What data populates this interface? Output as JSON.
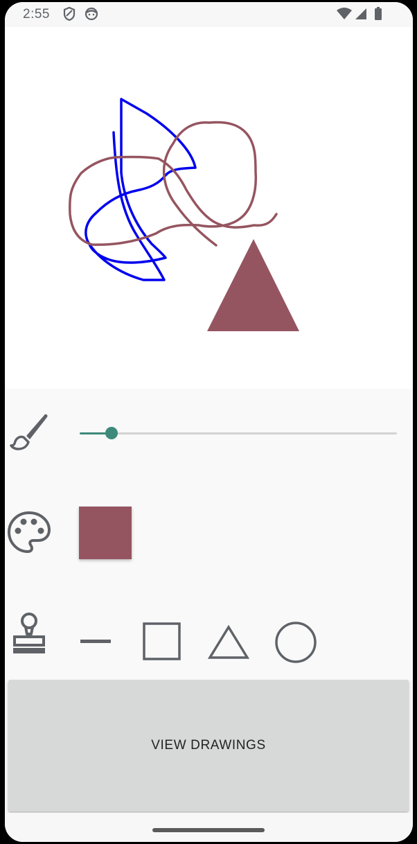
{
  "status_bar": {
    "time": "2:55",
    "left_icons": [
      "shield-icon",
      "face-icon"
    ],
    "right_icons": [
      "wifi-icon",
      "signal-icon",
      "battery-icon"
    ]
  },
  "canvas": {
    "background": "#ffffff",
    "strokes": [
      {
        "color": "#0000ee",
        "description": "blue freehand stroke"
      },
      {
        "color": "#955560",
        "description": "mauve freehand stroke"
      }
    ],
    "shapes": [
      {
        "type": "triangle",
        "color": "#955560"
      }
    ]
  },
  "controls": {
    "brush": {
      "icon": "brush-icon",
      "size_fraction": 0.1,
      "accent_color": "#3d8a7a"
    },
    "palette": {
      "icon": "palette-icon",
      "selected_color": "#955560"
    },
    "stamp": {
      "icon": "stamp-icon",
      "shapes": [
        "line-icon",
        "square-icon",
        "triangle-icon",
        "circle-icon"
      ]
    }
  },
  "view_button": {
    "label": "VIEW DRAWINGS"
  }
}
